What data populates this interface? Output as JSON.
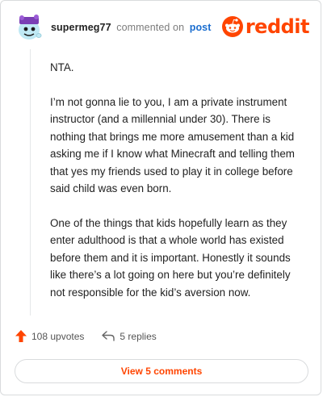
{
  "comment": {
    "username": "supermeg77",
    "action_text": "commented on",
    "post_link": "post",
    "paragraphs": [
      "NTA.",
      "I’m not gonna lie to you, I am a private instrument instructor (and a millennial under 30). There is nothing that brings me more amusement than a kid asking me if I know what Minecraft and telling them that yes my friends used to play it in college before said child was even born.",
      "One of the things that kids hopefully learn as they enter adulthood is that a whole world has existed before them and it is important. Honestly it sounds like there’s a lot going on here but you’re definitely not responsible for the kid’s aversion now."
    ],
    "upvotes_label": "108 upvotes",
    "replies_label": "5 replies",
    "view_comments_label": "View 5 comments"
  },
  "brand": {
    "name": "reddit",
    "color": "#ff4500"
  },
  "icons": {
    "upvote": "upvote-arrow-icon",
    "reply": "reply-arrow-icon",
    "logo": "reddit-snoo-icon",
    "avatar": "snoo-avatar-icon"
  }
}
